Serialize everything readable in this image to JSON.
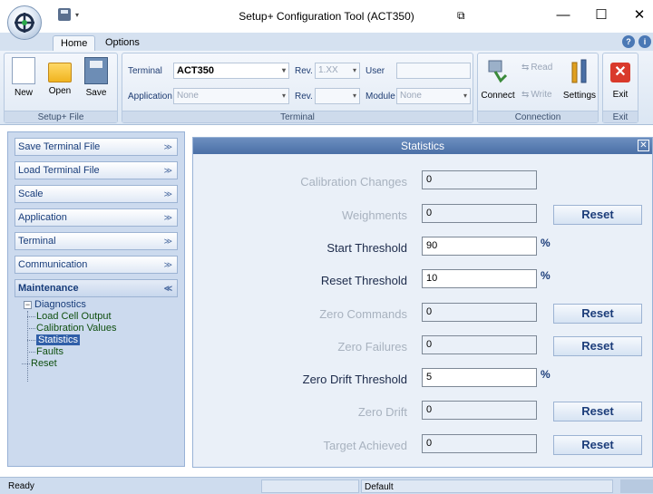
{
  "window": {
    "title": "Setup+ Configuration Tool (ACT350)"
  },
  "ribbon_tabs": [
    "Home",
    "Options"
  ],
  "ribbon": {
    "setup_file": {
      "label": "Setup+ File",
      "buttons": [
        "New",
        "Open",
        "Save"
      ]
    },
    "terminal": {
      "label": "Terminal",
      "terminal_label": "Terminal",
      "terminal_value": "ACT350",
      "rev_label": "Rev.",
      "rev_value": "1.XX",
      "user_label": "User",
      "user_value": "",
      "application_label": "Application",
      "application_value": "None",
      "rev2_label": "Rev.",
      "rev2_value": "",
      "module_label": "Module",
      "module_value": "None"
    },
    "connection": {
      "label": "Connection",
      "connect": "Connect",
      "read": "Read",
      "write": "Write",
      "settings": "Settings"
    },
    "exit": {
      "label": "Exit",
      "button": "Exit"
    }
  },
  "sidebar": {
    "sections": [
      "Save Terminal File",
      "Load Terminal File",
      "Scale",
      "Application",
      "Terminal",
      "Communication"
    ],
    "open_section": "Maintenance",
    "tree": {
      "root": "Diagnostics",
      "children": [
        "Load Cell Output",
        "Calibration Values",
        "Statistics",
        "Faults"
      ],
      "selected": "Statistics",
      "sibling": "Reset"
    }
  },
  "statistics": {
    "title": "Statistics",
    "rows": [
      {
        "label": "Calibration Changes",
        "value": "0",
        "enabled": false,
        "unit": "",
        "reset": ""
      },
      {
        "label": "Weighments",
        "value": "0",
        "enabled": false,
        "unit": "",
        "reset": "Reset"
      },
      {
        "label": "Start Threshold",
        "value": "90",
        "enabled": true,
        "unit": "%",
        "reset": ""
      },
      {
        "label": "Reset Threshold",
        "value": "10",
        "enabled": true,
        "unit": "%",
        "reset": ""
      },
      {
        "label": "Zero Commands",
        "value": "0",
        "enabled": false,
        "unit": "",
        "reset": "Reset"
      },
      {
        "label": "Zero Failures",
        "value": "0",
        "enabled": false,
        "unit": "",
        "reset": "Reset"
      },
      {
        "label": "Zero Drift Threshold",
        "value": "5",
        "enabled": true,
        "unit": "%",
        "reset": ""
      },
      {
        "label": "Zero Drift",
        "value": "0",
        "enabled": false,
        "unit": "",
        "reset": "Reset"
      },
      {
        "label": "Target Achieved",
        "value": "0",
        "enabled": false,
        "unit": "",
        "reset": "Reset"
      }
    ]
  },
  "statusbar": {
    "status": "Ready",
    "mode": "Default"
  }
}
